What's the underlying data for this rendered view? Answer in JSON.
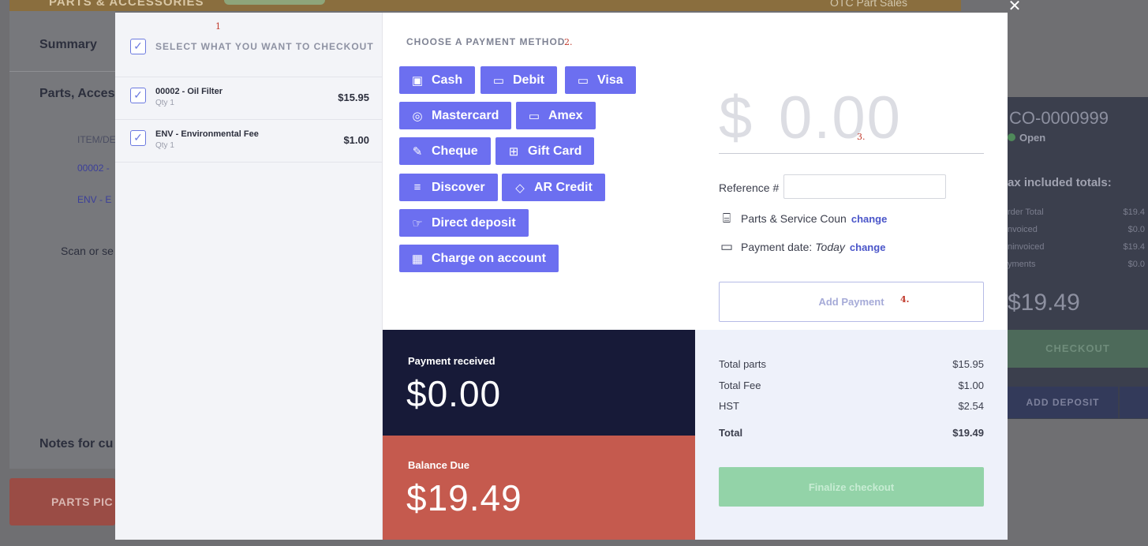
{
  "background": {
    "top_title": "PARTS & ACCESSORIES",
    "top_sales": "OTC Part Sales",
    "left_labels": [
      "Summary",
      "Parts, Acces",
      "ITEM/DE",
      "00002 -",
      "ENV - E",
      "Scan or se",
      "Notes for cu"
    ],
    "parts_pick_label": "PARTS PIC",
    "order_id": "CO-0000999",
    "order_status": "Open",
    "tax_heading": "ax included totals:",
    "tax_rows": [
      {
        "label": "rder Total",
        "value": "$19.4"
      },
      {
        "label": "nvoiced",
        "value": "$0.0"
      },
      {
        "label": "ninvoiced",
        "value": "$19.4"
      },
      {
        "label": "yments",
        "value": "$0.0"
      }
    ],
    "big_total": "$19.49",
    "checkout_label": "CHECKOUT",
    "deposit_label": "ADD DEPOSIT"
  },
  "modal": {
    "close_icon": "close-icon",
    "annotations": {
      "a1": "1",
      "a2": "2.",
      "a3": "3.",
      "a4": "4."
    },
    "select_all_label": "SELECT WHAT YOU WANT TO CHECKOUT",
    "items": [
      {
        "name": "00002 - Oil Filter",
        "qty": "Qty 1",
        "price": "$15.95",
        "checked": true
      },
      {
        "name": "ENV - Environmental Fee",
        "qty": "Qty 1",
        "price": "$1.00",
        "checked": true
      }
    ],
    "payment_method_label": "CHOOSE A PAYMENT METHOD",
    "payment_methods": [
      {
        "label": "Cash",
        "icon": "cash-icon"
      },
      {
        "label": "Debit",
        "icon": "debit-card-icon"
      },
      {
        "label": "Visa",
        "icon": "visa-icon"
      },
      {
        "label": "Mastercard",
        "icon": "mastercard-icon"
      },
      {
        "label": "Amex",
        "icon": "amex-icon"
      },
      {
        "label": "Cheque",
        "icon": "cheque-icon"
      },
      {
        "label": "Gift Card",
        "icon": "gift-card-icon"
      },
      {
        "label": "Discover",
        "icon": "discover-icon"
      },
      {
        "label": "AR Credit",
        "icon": "ar-credit-icon"
      },
      {
        "label": "Direct deposit",
        "icon": "direct-deposit-icon"
      },
      {
        "label": "Charge on account",
        "icon": "charge-account-icon"
      }
    ],
    "amount_currency": "$",
    "amount_value": "0.00",
    "reference_label": "Reference #",
    "reference_value": "",
    "register_label": "Parts & Service Coun",
    "register_change": "change",
    "payment_date_label": "Payment date:",
    "payment_date_value": "Today",
    "payment_date_change": "change",
    "add_payment_label": "Add Payment",
    "payment_received_label": "Payment received",
    "payment_received_value": "$0.00",
    "balance_due_label": "Balance Due",
    "balance_due_value": "$19.49",
    "totals": [
      {
        "label": "Total parts",
        "value": "$15.95"
      },
      {
        "label": "Total Fee",
        "value": "$1.00"
      },
      {
        "label": "HST",
        "value": "$2.54"
      }
    ],
    "grand_total_label": "Total",
    "grand_total_value": "$19.49",
    "finalize_label": "Finalize checkout"
  },
  "colors": {
    "accent": "#6c6ff0",
    "navy": "#171a38",
    "balance_red": "#c55a4e",
    "finalize_green": "#93d3a8"
  }
}
